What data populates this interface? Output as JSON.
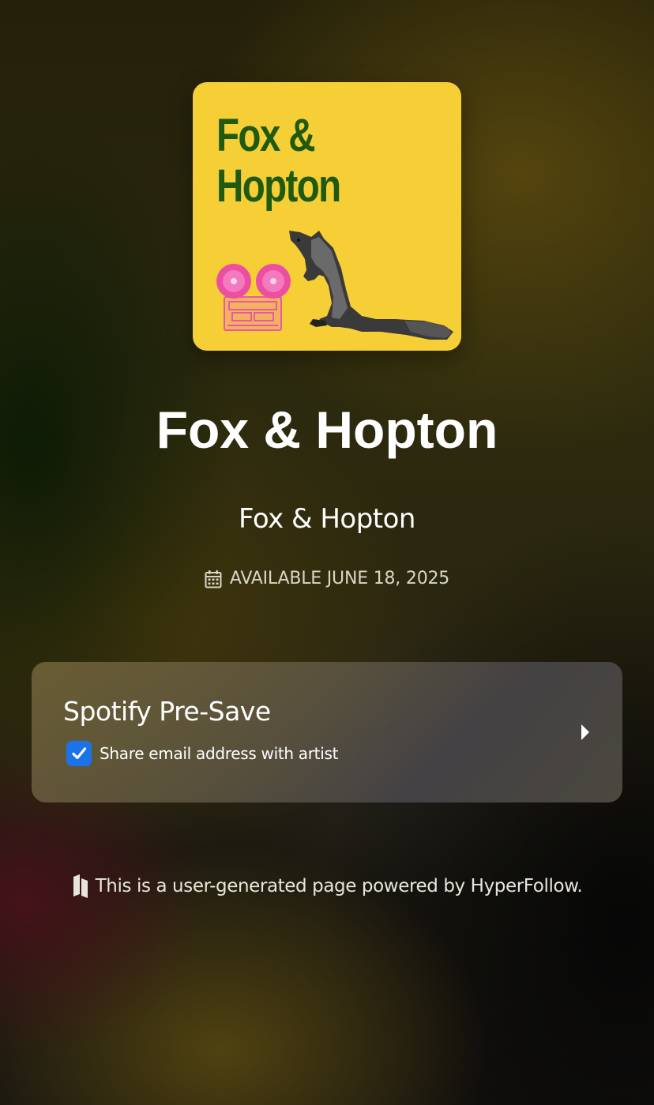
{
  "release": {
    "cover_text": "Fox &\nHopton",
    "title": "Fox & Hopton",
    "artist": "Fox & Hopton",
    "availability": "AVAILABLE JUNE 18, 2025"
  },
  "presave": {
    "label": "Spotify Pre-Save",
    "consent_label": "Share email address with artist",
    "consent_checked": true
  },
  "footer": {
    "text": "This is a user-generated page powered by HyperFollow."
  },
  "icons": {
    "calendar": "calendar-icon",
    "checkmark": "checkmark-icon",
    "chevron": "chevron-right-icon",
    "brand": "hyperfollow-icon"
  },
  "colors": {
    "cover_background": "#f5cf35",
    "cover_title": "#1f5a10",
    "checkbox": "#1a73e8",
    "text_primary": "#ffffff"
  }
}
